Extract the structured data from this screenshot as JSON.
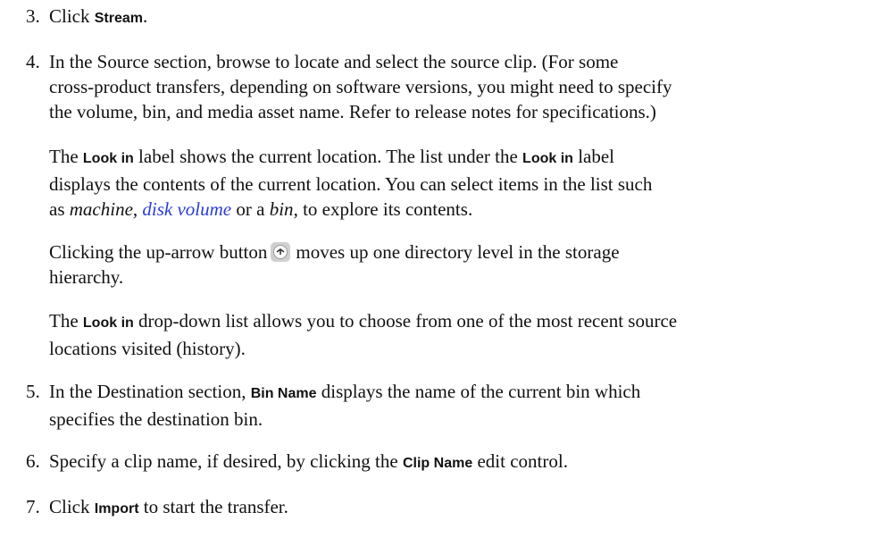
{
  "steps": [
    {
      "number": "3.",
      "before": "Click ",
      "ui": "Stream",
      "after": "."
    },
    {
      "number": "4.",
      "line1": "In the Source section, browse to locate and select the source clip. (For some",
      "line2": "cross-product transfers, depending on software versions, you might need to specify",
      "line3": "the volume, bin, and media asset name. Refer to release notes for specifications.)"
    },
    {
      "number": "5.",
      "before": "In the Destination section, ",
      "ui": "Bin Name",
      "after": " displays the name of the current bin which",
      "line2": "specifies the destination bin."
    },
    {
      "number": "6.",
      "before": "Specify a clip name, if desired, by clicking the ",
      "ui": "Clip Name",
      "after": " edit control."
    },
    {
      "number": "7.",
      "before": "Click ",
      "ui": "Import",
      "after": " to start the transfer."
    }
  ],
  "para_lookin": {
    "t1": "The ",
    "ui1": "Look in",
    "t2": " label shows the current location. The list under the ",
    "ui2": "Look in",
    "t3": " label",
    "line2": "displays the contents of the current location. You can select items in the list such",
    "t4": "as ",
    "em1": "machine",
    "t5": ", ",
    "link1": "disk volume",
    "t6": " or a ",
    "em2": "bin",
    "t7": ", to explore its contents."
  },
  "para_uparrow": {
    "before": "Clicking the up-arrow button",
    "after": "moves up one directory level in the storage",
    "line2": "hierarchy.",
    "icon": "up-arrow-icon"
  },
  "para_dropdown": {
    "t1": "The ",
    "ui1": "Look in",
    "t2": " drop-down list allows you to choose from one of the most recent source",
    "line2": "locations visited (history)."
  },
  "colors": {
    "link": "#2a3bd8",
    "button_bg": "#d0d0d0"
  }
}
